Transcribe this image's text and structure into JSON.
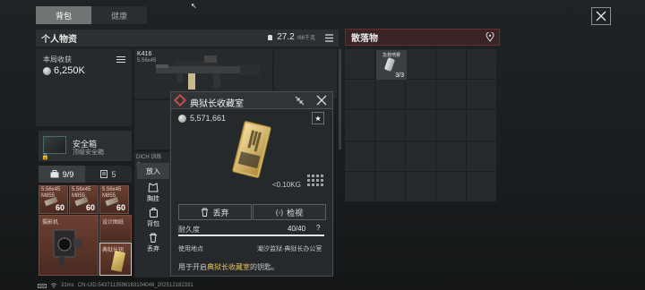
{
  "top_tabs": [
    {
      "label": "背包",
      "active": true
    },
    {
      "label": "健康",
      "active": false
    }
  ],
  "cursor_glyph": "↖",
  "personal": {
    "title": "个人物资",
    "weight": "27.2",
    "weight_unit": "/66千克",
    "income_label": "本局收获",
    "income_value": "6,250K"
  },
  "safe_box": {
    "title": "安全箱",
    "subtitle": "顶级安全箱",
    "lock_glyph": "🔒"
  },
  "pouch_tabs": [
    {
      "count": "9/9",
      "active": true
    },
    {
      "count": "5",
      "active": false
    }
  ],
  "ammo": [
    {
      "name": "5.56x45\nM855",
      "count": "60"
    },
    {
      "name": "5.56x45\nM855",
      "count": "60"
    },
    {
      "name": "5.56x45\nM855",
      "count": "60"
    }
  ],
  "gear_cell_label": "摄影机",
  "design_cell_label": "设计图纸",
  "key_cell_label": "典狱长钥",
  "weapon": {
    "name": "K416",
    "sub": "5.56x45"
  },
  "vest_label": "DICH 训练头...",
  "actions": [
    {
      "label": "放入"
    },
    {
      "label": "胸挂"
    },
    {
      "label": "背包"
    },
    {
      "label": "丢弃"
    }
  ],
  "popup": {
    "title": "典狱长收藏室",
    "price": "5,571,661",
    "star": "★",
    "weight": "<0.10KG",
    "discard_label": "丢弃",
    "inspect_label": "检视",
    "durability_label": "耐久度",
    "durability_value": "40/40",
    "durability_fraction": 1.0,
    "help": "?",
    "use_label": "使用地点",
    "use_value": "潮汐监狱·典狱长办公室",
    "desc_prefix": "用于开启",
    "desc_highlight": "典狱长收藏室",
    "desc_suffix": "的钥匙。"
  },
  "loot": {
    "title": "散落物",
    "item_label": "急救喷雾",
    "item_count": "3/3"
  },
  "status": {
    "ping": "31ms",
    "uid": "CN-UID:5437113596183104046_202512182331"
  },
  "colors": {
    "accent_red": "#c94a4a",
    "highlight_gold": "#e8c15a",
    "ammo_brown": "#6b3f31",
    "loot_header_red": "#3a2325"
  }
}
